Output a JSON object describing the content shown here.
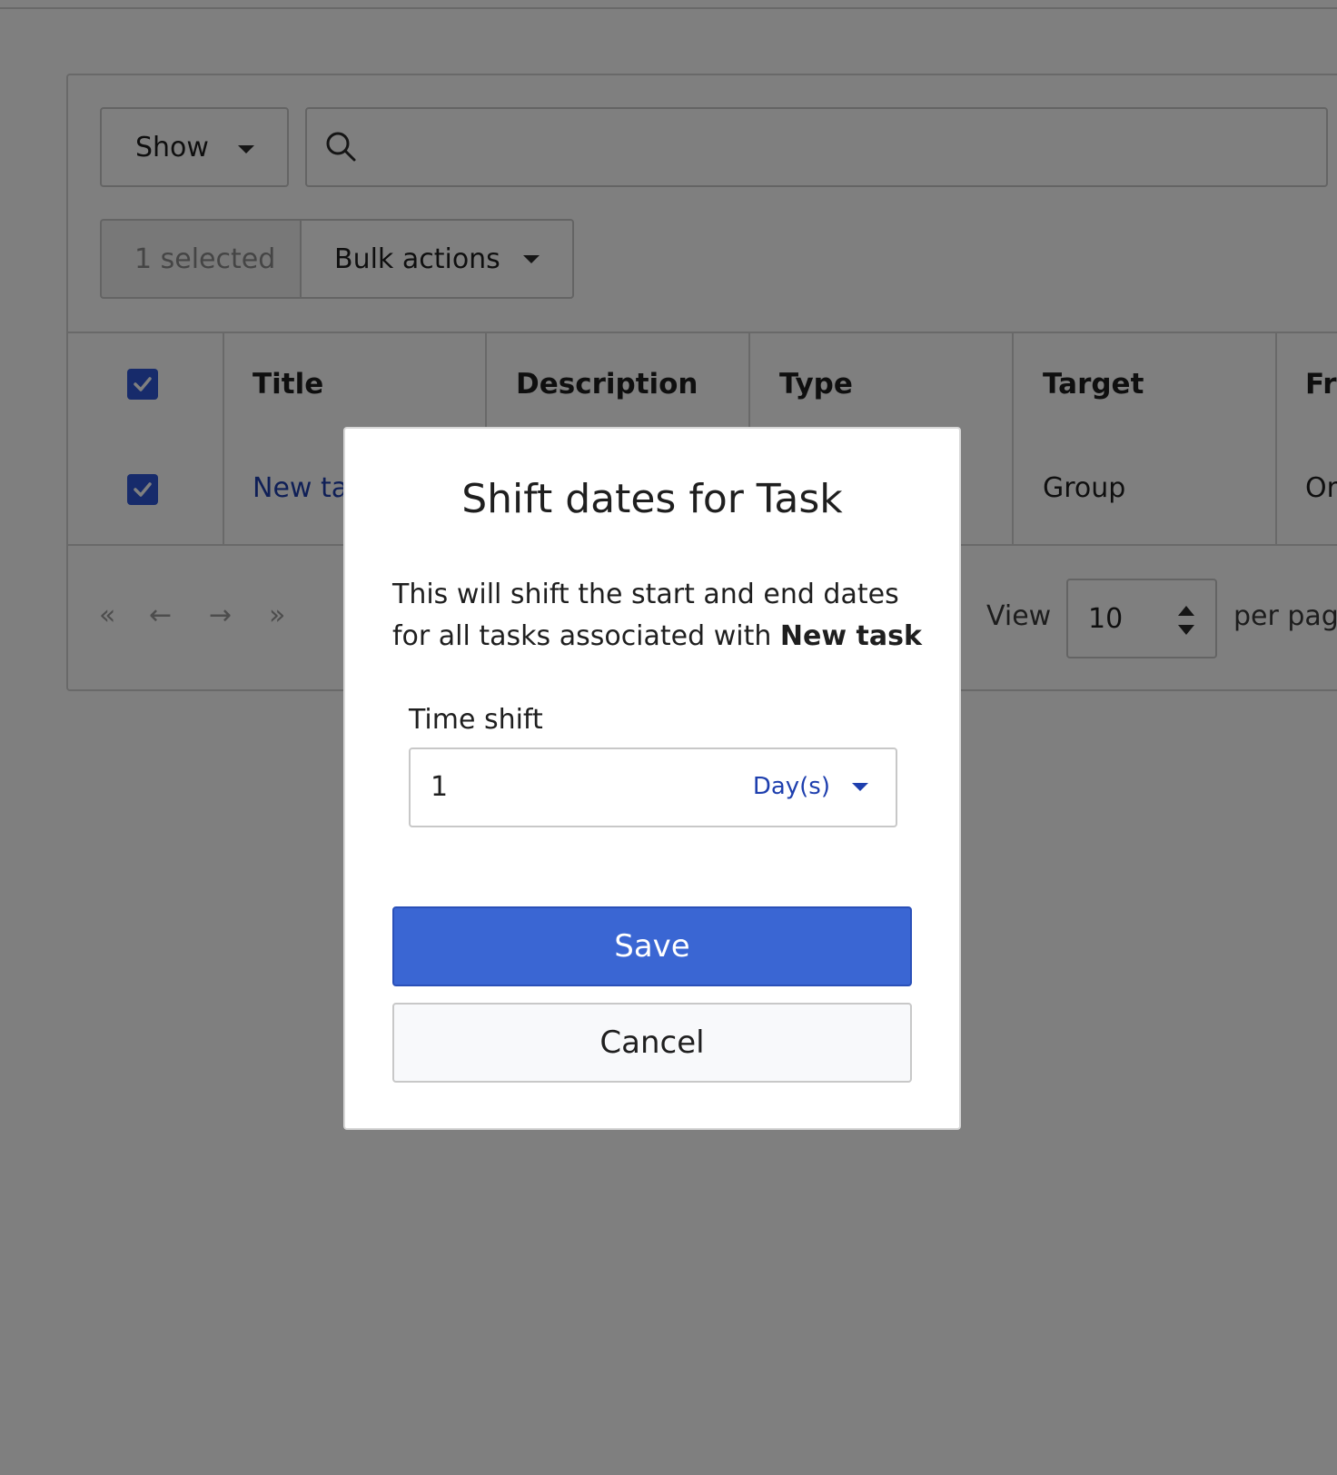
{
  "toolbar": {
    "show_label": "Show",
    "search_placeholder": "",
    "selected_count": "1 selected",
    "bulk_actions_label": "Bulk actions"
  },
  "table": {
    "headers": [
      "Title",
      "Description",
      "Type",
      "Target",
      "Fr"
    ],
    "rows": [
      {
        "title": "New ta",
        "target": "Group",
        "fr": "Or"
      }
    ]
  },
  "pagination": {
    "first": "«",
    "prev": "←",
    "next": "→",
    "last": "»",
    "view_label": "View",
    "per_page_value": "10",
    "per_page_label": "per pag"
  },
  "modal": {
    "title": "Shift dates for Task",
    "body_text": "This will shift the start and end dates for all tasks associated with ",
    "body_bold": "New task",
    "field_label": "Time shift",
    "time_value": "1",
    "unit": "Day(s)",
    "save_label": "Save",
    "cancel_label": "Cancel"
  },
  "colors": {
    "primary": "#3a66d3",
    "link": "#1e3fae",
    "checkbox": "#2e56d6"
  }
}
